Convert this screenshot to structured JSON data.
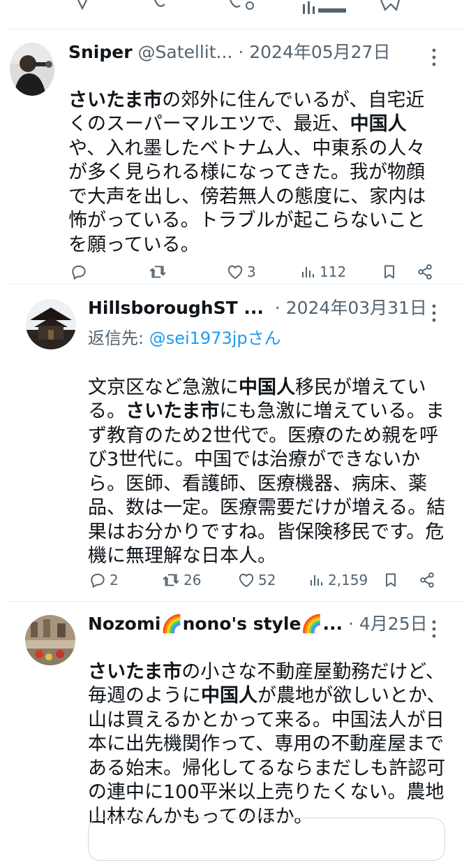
{
  "tweets": [
    {
      "name": "Sniper",
      "handle": "@Satellit...",
      "date": "· 2024年05月27日",
      "body": [
        {
          "t": "さいたま市",
          "b": true
        },
        {
          "t": "の郊外に住んでいるが、自宅近くのスーパーマルエツで、最近、",
          "b": false
        },
        {
          "t": "中国人",
          "b": true
        },
        {
          "t": "や、入れ墨したベトナム人、中東系の人々が多く見られる様になってきた。我が物顔で大声を出し、傍若無人の態度に、家内は怖がっている。トラブルが起こらないことを願っている。",
          "b": false
        }
      ],
      "stats": {
        "replies": "",
        "retweets": "",
        "likes": "3",
        "views": "112"
      }
    },
    {
      "name": "HillsboroughST ...",
      "date": "· 2024年03月31日",
      "reply_prefix": "返信先: ",
      "reply_mention": "@sei1973jpさん",
      "body": [
        {
          "t": "文京区など急激に",
          "b": false
        },
        {
          "t": "中国人",
          "b": true
        },
        {
          "t": "移民が増えている。",
          "b": false
        },
        {
          "t": "さいたま市",
          "b": true
        },
        {
          "t": "にも急激に増えている。まず教育のため2世代で。医療のため親を呼び3世代に。中国では治療ができないから。医師、看護師、医療機器、病床、薬品、数は一定。医療需要だけが増える。結果はお分かりですね。皆保険移民です。危機に無理解な日本人。",
          "b": false
        }
      ],
      "stats": {
        "replies": "2",
        "retweets": "26",
        "likes": "52",
        "views": "2,159"
      }
    },
    {
      "name": "Nozomi🌈nono's style🌈...",
      "date": "· 4月25日",
      "body": [
        {
          "t": "さいたま市",
          "b": true
        },
        {
          "t": "の小さな不動産屋勤務だけど、毎週のように",
          "b": false
        },
        {
          "t": "中国人",
          "b": true
        },
        {
          "t": "が農地が欲しいとか、山は買えるかとかって来る。中国法人が日本に出先機関作って、専用の不動産屋まである始末。帰化してるならまだしも許認可の連中に100平米以上売りたくない。農地山林なんかもってのほか。",
          "b": false
        }
      ]
    }
  ],
  "colors": {
    "text": "#0f1419",
    "muted": "#536471",
    "link": "#1d9bf0",
    "divider": "#e6ecf0"
  },
  "icons": [
    "reply-icon",
    "retweet-icon",
    "like-icon",
    "views-icon",
    "bookmark-icon",
    "share-icon",
    "more-icon"
  ]
}
